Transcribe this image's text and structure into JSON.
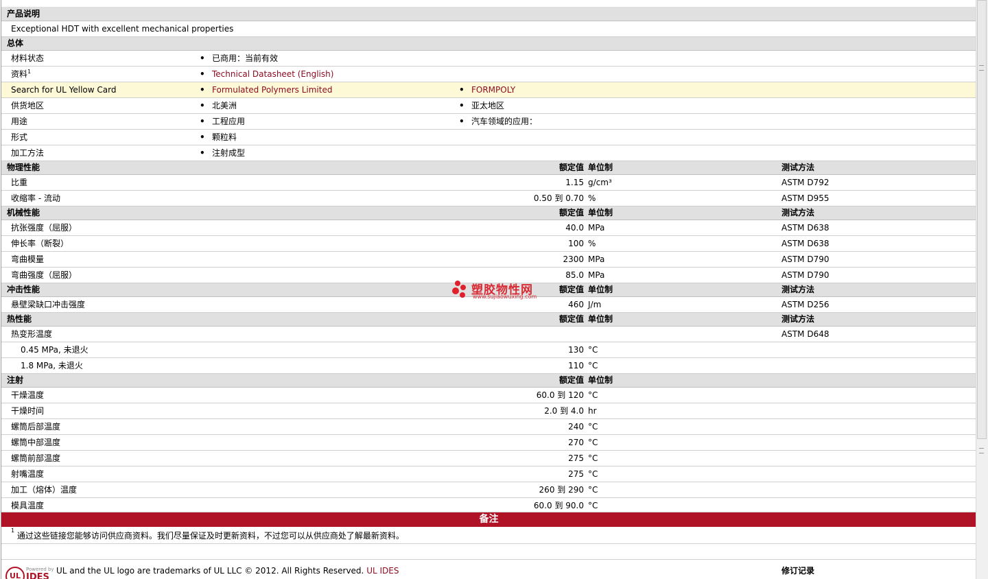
{
  "sections": {
    "description": {
      "title": "产品说明",
      "text": "Exceptional HDT with excellent mechanical properties"
    },
    "general": {
      "title": "总体",
      "rows": [
        {
          "label": "材料状态",
          "c1": "已商用：当前有效",
          "c2": ""
        },
        {
          "label": "资料",
          "sup": "1",
          "c1": "Technical Datasheet (English)",
          "c2": ""
        },
        {
          "label": "Search for UL Yellow Card",
          "c1": "Formulated Polymers Limited",
          "c2": "FORMPOLY"
        },
        {
          "label": "供货地区",
          "c1": "北美洲",
          "c2": "亚太地区"
        },
        {
          "label": "用途",
          "c1": "工程应用",
          "c2": "汽车领域的应用："
        },
        {
          "label": "形式",
          "c1": "颗粒料",
          "c2": ""
        },
        {
          "label": "加工方法",
          "c1": "注射成型",
          "c2": ""
        }
      ]
    },
    "col_headers": {
      "nominal": "额定值",
      "unit": "单位制",
      "method": "测试方法"
    },
    "physical": {
      "title": "物理性能",
      "rows": [
        {
          "label": "比重",
          "value": "1.15",
          "unit": "g/cm³",
          "method": "ASTM D792"
        },
        {
          "label": "收缩率  - 流动",
          "value": "0.50 到  0.70",
          "unit": "%",
          "method": "ASTM D955"
        }
      ]
    },
    "mechanical": {
      "title": "机械性能",
      "rows": [
        {
          "label": "抗张强度（屈服）",
          "value": "40.0",
          "unit": "MPa",
          "method": "ASTM D638"
        },
        {
          "label": "伸长率（断裂）",
          "value": "100",
          "unit": "%",
          "method": "ASTM D638"
        },
        {
          "label": "弯曲模量",
          "value": "2300",
          "unit": "MPa",
          "method": "ASTM D790"
        },
        {
          "label": "弯曲强度（屈服）",
          "value": "85.0",
          "unit": "MPa",
          "method": "ASTM D790"
        }
      ]
    },
    "impact": {
      "title": "冲击性能",
      "rows": [
        {
          "label": "悬壁梁缺口冲击强度",
          "value": "460",
          "unit": "J/m",
          "method": "ASTM D256"
        }
      ]
    },
    "thermal": {
      "title": "热性能",
      "rows": [
        {
          "label": "热变形温度",
          "value": "",
          "unit": "",
          "method": "ASTM D648"
        },
        {
          "label": "0.45 MPa, 未退火",
          "value": "130",
          "unit": "°C",
          "method": ""
        },
        {
          "label": "1.8 MPa, 未退火",
          "value": "110",
          "unit": "°C",
          "method": ""
        }
      ]
    },
    "injection": {
      "title": "注射",
      "rows": [
        {
          "label": "干燥温度",
          "value": "60.0 到  120",
          "unit": "°C"
        },
        {
          "label": "干燥时间",
          "value": "2.0 到  4.0",
          "unit": "hr"
        },
        {
          "label": "螺筒后部温度",
          "value": "240",
          "unit": "°C"
        },
        {
          "label": "螺筒中部温度",
          "value": "270",
          "unit": "°C"
        },
        {
          "label": "螺筒前部温度",
          "value": "275",
          "unit": "°C"
        },
        {
          "label": "射嘴温度",
          "value": "275",
          "unit": "°C"
        },
        {
          "label": "加工（熔体）温度",
          "value": "260 到  290",
          "unit": "°C"
        },
        {
          "label": "模具温度",
          "value": "60.0 到  90.0",
          "unit": "°C"
        }
      ]
    }
  },
  "notes": {
    "title": "备注",
    "sup": "1",
    "text": "通过这些链接您能够访问供应商资料。我们尽量保证及时更新资料，不过您可以从供应商处了解最新资料。"
  },
  "watermark": {
    "title": "塑胶物性网",
    "url": "www.sujiaowuxing.com"
  },
  "footer": {
    "logo": "UL",
    "powered": "Powered by",
    "ides": "IDES",
    "text": "UL and the UL logo are trademarks of UL LLC © 2012. All Rights Reserved.",
    "link": "UL IDES",
    "revision": "修订记录"
  },
  "colors": {
    "accent": "#b01326",
    "link": "#8b0a1e",
    "header_bg": "#e0e0e0",
    "highlight_bg": "#fdf8d6"
  }
}
